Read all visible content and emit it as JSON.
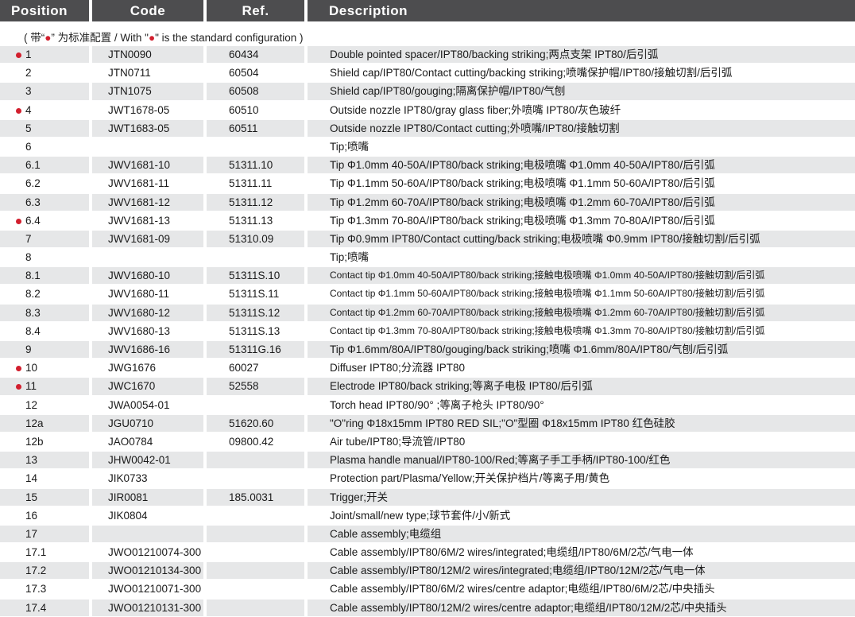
{
  "header": {
    "position": "Position",
    "code": "Code",
    "ref": "Ref.",
    "description": "Description"
  },
  "note": {
    "prefix": "( 带“",
    "dot1": "●",
    "mid": "” 为标准配置 / With \"",
    "dot2": "●",
    "suffix": "\" is the standard configuration )"
  },
  "colors": {
    "accent_red": "#d21f2e",
    "header_bg": "#4d4d4f",
    "row_shade": "#e6e7e8"
  },
  "rows": [
    {
      "pos": "1",
      "code": "JTN0090",
      "ref": "60434",
      "desc": "Double pointed spacer/IPT80/backing striking;两点支架 IPT80/后引弧",
      "std": true
    },
    {
      "pos": "2",
      "code": "JTN0711",
      "ref": "60504",
      "desc": "Shield cap/IPT80/Contact cutting/backing striking;喷嘴保护帽/IPT80/接触切割/后引弧",
      "std": false
    },
    {
      "pos": "3",
      "code": "JTN1075",
      "ref": "60508",
      "desc": "Shield cap/IPT80/gouging;隔离保护帽/IPT80/气刨",
      "std": false
    },
    {
      "pos": "4",
      "code": "JWT1678-05",
      "ref": "60510",
      "desc": "Outside nozzle IPT80/gray glass fiber;外喷嘴 IPT80/灰色玻纤",
      "std": true
    },
    {
      "pos": "5",
      "code": "JWT1683-05",
      "ref": "60511",
      "desc": "Outside nozzle IPT80/Contact cutting;外喷嘴/IPT80/接触切割",
      "std": false
    },
    {
      "pos": "6",
      "code": "",
      "ref": "",
      "desc": "Tip;喷嘴",
      "std": false
    },
    {
      "pos": "6.1",
      "code": "JWV1681-10",
      "ref": "51311.10",
      "desc": "Tip Φ1.0mm 40-50A/IPT80/back striking;电极喷嘴 Φ1.0mm 40-50A/IPT80/后引弧",
      "std": false
    },
    {
      "pos": "6.2",
      "code": "JWV1681-11",
      "ref": "51311.11",
      "desc": "Tip Φ1.1mm 50-60A/IPT80/back striking;电极喷嘴 Φ1.1mm 50-60A/IPT80/后引弧",
      "std": false
    },
    {
      "pos": "6.3",
      "code": "JWV1681-12",
      "ref": "51311.12",
      "desc": "Tip Φ1.2mm 60-70A/IPT80/back striking;电极喷嘴 Φ1.2mm 60-70A/IPT80/后引弧",
      "std": false
    },
    {
      "pos": "6.4",
      "code": "JWV1681-13",
      "ref": "51311.13",
      "desc": "Tip Φ1.3mm 70-80A/IPT80/back striking;电极喷嘴 Φ1.3mm 70-80A/IPT80/后引弧",
      "std": true
    },
    {
      "pos": "7",
      "code": "JWV1681-09",
      "ref": "51310.09",
      "desc": "Tip Φ0.9mm IPT80/Contact cutting/back striking;电极喷嘴 Φ0.9mm IPT80/接触切割/后引弧",
      "std": false
    },
    {
      "pos": "8",
      "code": "",
      "ref": "",
      "desc": "Tip;喷嘴",
      "std": false
    },
    {
      "pos": "8.1",
      "code": "JWV1680-10",
      "ref": "51311S.10",
      "desc": "Contact tip Φ1.0mm 40-50A/IPT80/back striking;接触电极喷嘴 Φ1.0mm 40-50A/IPT80/接触切割/后引弧",
      "std": false,
      "small": true
    },
    {
      "pos": "8.2",
      "code": "JWV1680-11",
      "ref": "51311S.11",
      "desc": "Contact tip Φ1.1mm 50-60A/IPT80/back striking;接触电极喷嘴 Φ1.1mm 50-60A/IPT80/接触切割/后引弧",
      "std": false,
      "small": true
    },
    {
      "pos": "8.3",
      "code": "JWV1680-12",
      "ref": "51311S.12",
      "desc": "Contact tip Φ1.2mm 60-70A/IPT80/back striking;接触电极喷嘴 Φ1.2mm 60-70A/IPT80/接触切割/后引弧",
      "std": false,
      "small": true
    },
    {
      "pos": "8.4",
      "code": "JWV1680-13",
      "ref": "51311S.13",
      "desc": "Contact tip Φ1.3mm 70-80A/IPT80/back striking;接触电极喷嘴 Φ1.3mm 70-80A/IPT80/接触切割/后引弧",
      "std": false,
      "small": true
    },
    {
      "pos": "9",
      "code": "JWV1686-16",
      "ref": "51311G.16",
      "desc": "Tip Φ1.6mm/80A/IPT80/gouging/back striking;喷嘴 Φ1.6mm/80A/IPT80/气刨/后引弧",
      "std": false
    },
    {
      "pos": "10",
      "code": "JWG1676",
      "ref": "60027",
      "desc": "Diffuser IPT80;分流器 IPT80",
      "std": true
    },
    {
      "pos": "11",
      "code": "JWC1670",
      "ref": "52558",
      "desc": "Electrode IPT80/back striking;等离子电极 IPT80/后引弧",
      "std": true
    },
    {
      "pos": "12",
      "code": "JWA0054-01",
      "ref": "",
      "desc": "Torch head IPT80/90°  ;等离子枪头 IPT80/90°",
      "std": false
    },
    {
      "pos": "12a",
      "code": "JGU0710",
      "ref": "51620.60",
      "desc": "\"O\"ring Φ18x15mm IPT80 RED SIL;\"O\"型圈 Φ18x15mm IPT80 红色硅胶",
      "std": false
    },
    {
      "pos": "12b",
      "code": "JAO0784",
      "ref": "09800.42",
      "desc": "Air tube/IPT80;导流管/IPT80",
      "std": false
    },
    {
      "pos": "13",
      "code": "JHW0042-01",
      "ref": "",
      "desc": "Plasma handle manual/IPT80-100/Red;等离子手工手柄/IPT80-100/红色",
      "std": false
    },
    {
      "pos": "14",
      "code": "JIK0733",
      "ref": "",
      "desc": "Protection part/Plasma/Yellow;开关保护档片/等离子用/黄色",
      "std": false
    },
    {
      "pos": "15",
      "code": "JIR0081",
      "ref": "185.0031",
      "desc": "Trigger;开关",
      "std": false
    },
    {
      "pos": "16",
      "code": "JIK0804",
      "ref": "",
      "desc": "Joint/small/new type;球节套件/小/新式",
      "std": false
    },
    {
      "pos": "17",
      "code": "",
      "ref": "",
      "desc": "Cable assembly;电缆组",
      "std": false
    },
    {
      "pos": "17.1",
      "code": "JWO01210074-300",
      "ref": "",
      "desc": "Cable assembly/IPT80/6M/2 wires/integrated;电缆组/IPT80/6M/2芯/气电一体",
      "std": false
    },
    {
      "pos": "17.2",
      "code": "JWO01210134-300",
      "ref": "",
      "desc": "Cable assembly/IPT80/12M/2 wires/integrated;电缆组/IPT80/12M/2芯/气电一体",
      "std": false
    },
    {
      "pos": "17.3",
      "code": "JWO01210071-300",
      "ref": "",
      "desc": "Cable assembly/IPT80/6M/2 wires/centre adaptor;电缆组/IPT80/6M/2芯/中央插头",
      "std": false
    },
    {
      "pos": "17.4",
      "code": "JWO01210131-300",
      "ref": "",
      "desc": "Cable assembly/IPT80/12M/2 wires/centre adaptor;电缆组/IPT80/12M/2芯/中央插头",
      "std": false
    }
  ]
}
